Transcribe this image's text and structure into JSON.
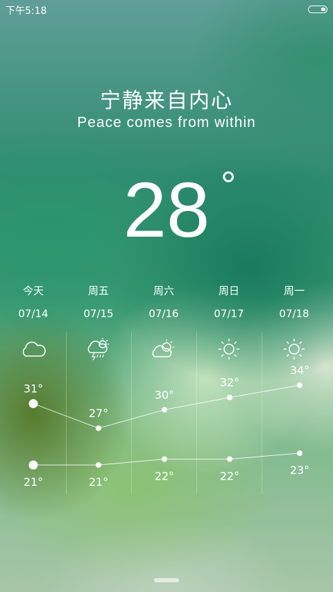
{
  "status": {
    "time": "下午5:18",
    "battery_level": 0.25
  },
  "quote": {
    "cn": "宁静来自内心",
    "en": "Peace comes from within"
  },
  "current": {
    "temp": "28",
    "unit": "°"
  },
  "forecast": [
    {
      "day": "今天",
      "date": "07/14",
      "icon": "cloud-icon",
      "high": "31°",
      "low": "21°"
    },
    {
      "day": "周五",
      "date": "07/15",
      "icon": "thunderstorm-rain-icon",
      "high": "27°",
      "low": "21°"
    },
    {
      "day": "周六",
      "date": "07/16",
      "icon": "partly-cloudy-icon",
      "high": "30°",
      "low": "22°"
    },
    {
      "day": "周日",
      "date": "07/17",
      "icon": "sun-icon",
      "high": "32°",
      "low": "22°"
    },
    {
      "day": "周一",
      "date": "07/18",
      "icon": "sun-icon",
      "high": "34°",
      "low": "23°"
    }
  ],
  "chart_data": {
    "type": "line",
    "categories": [
      "07/14",
      "07/15",
      "07/16",
      "07/17",
      "07/18"
    ],
    "series": [
      {
        "values": [
          31,
          27,
          30,
          32,
          34
        ]
      },
      {
        "values": [
          21,
          21,
          22,
          22,
          23
        ]
      }
    ],
    "unit": "°"
  }
}
